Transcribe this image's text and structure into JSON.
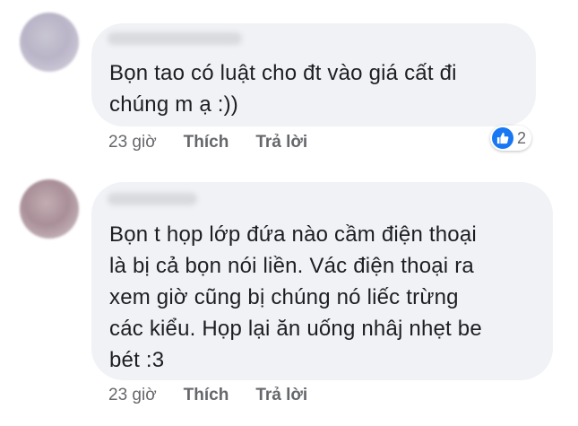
{
  "comments": [
    {
      "text": "Bọn tao có luật cho đt vào giá cất đi\nchúng m ạ :))",
      "time": "23 giờ",
      "like_label": "Thích",
      "reply_label": "Trả lời",
      "reactions": {
        "icon": "like-icon",
        "count": "2",
        "color": "#1877f2"
      }
    },
    {
      "text": "Bọn t họp lớp đứa nào cầm điện thoại\nlà bị cả bọn nói liền. Vác điện thoại ra\nxem giờ cũng bị chúng nó liếc trừng\ncác kiểu. Họp lại ăn uống nhâj nhẹt be\nbét :3",
      "time": "23 giờ",
      "like_label": "Thích",
      "reply_label": "Trả lời"
    }
  ]
}
